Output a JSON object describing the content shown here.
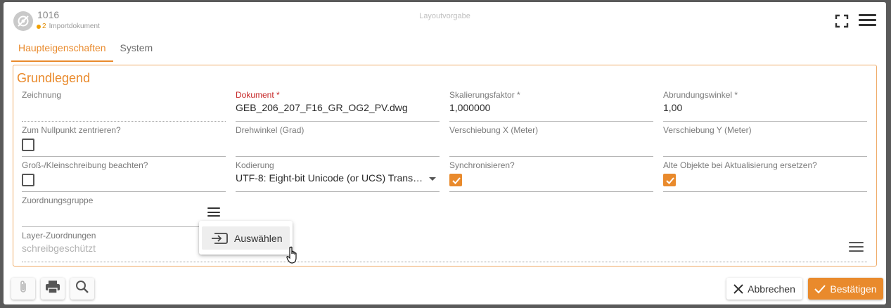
{
  "header": {
    "number": "1016",
    "sub_count": "2",
    "sub_label": "Importdokument",
    "center_title": "Layoutvorgabe",
    "logo_icon": "eye-off-icon",
    "fullscreen_icon": "fullscreen-icon",
    "menu_icon": "hamburger-menu-icon"
  },
  "tabs": [
    {
      "label": "Haupteigenschaften",
      "active": true
    },
    {
      "label": "System",
      "active": false
    }
  ],
  "group": {
    "title": "Grundlegend",
    "fields": {
      "zeichnung": {
        "label": "Zeichnung",
        "value": ""
      },
      "dokument": {
        "label": "Dokument *",
        "value": "GEB_206_207_F16_GR_OG2_PV.dwg"
      },
      "skalierungsfaktor": {
        "label": "Skalierungsfaktor *",
        "value": "1,000000"
      },
      "abrundungswinkel": {
        "label": "Abrundungswinkel *",
        "value": "1,00"
      },
      "nullpunkt": {
        "label": "Zum Nullpunkt zentrieren?",
        "checked": false
      },
      "drehwinkel": {
        "label": "Drehwinkel (Grad)",
        "value": ""
      },
      "verschiebung_x": {
        "label": "Verschiebung X (Meter)",
        "value": ""
      },
      "verschiebung_y": {
        "label": "Verschiebung Y (Meter)",
        "value": ""
      },
      "grossklein": {
        "label": "Groß-/Kleinschreibung beachten?",
        "checked": false
      },
      "kodierung": {
        "label": "Kodierung",
        "value": "UTF-8: Eight-bit Unicode (or UCS) Transf…"
      },
      "synchronisieren": {
        "label": "Synchronisieren?",
        "checked": true
      },
      "alte_objekte": {
        "label": "Alte Objekte bei Aktualisierung ersetzen?",
        "checked": true
      },
      "zuordnungsgruppe": {
        "label": "Zuordnungsgruppe",
        "value": ""
      },
      "layer_zuordnungen": {
        "label": "Layer-Zuordnungen",
        "value": "schreibgeschützt"
      }
    }
  },
  "context_menu": {
    "items": [
      {
        "label": "Auswählen",
        "icon": "select-arrow-icon"
      }
    ]
  },
  "footer": {
    "attach_icon": "paperclip-icon",
    "print_icon": "printer-icon",
    "search_icon": "search-icon",
    "cancel_label": "Abbrechen",
    "confirm_label": "Bestätigen"
  },
  "colors": {
    "accent": "#e98a2c",
    "required": "#c62828"
  }
}
